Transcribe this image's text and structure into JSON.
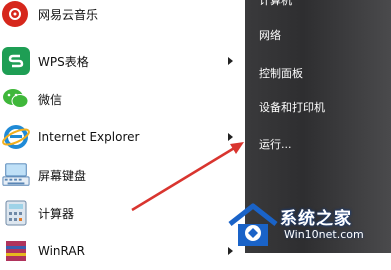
{
  "start_menu_left": {
    "items": [
      {
        "label": "网易云音乐",
        "icon": "netease-music-icon",
        "color": "#d6271c",
        "has_submenu": false
      },
      {
        "label": "WPS表格",
        "icon": "wps-spreadsheet-icon",
        "color": "#1e9e54",
        "has_submenu": true
      },
      {
        "label": "微信",
        "icon": "wechat-icon",
        "color": "#3fb73a",
        "has_submenu": false
      },
      {
        "label": "Internet Explorer",
        "icon": "internet-explorer-icon",
        "color": "#1f8ad6",
        "has_submenu": true
      },
      {
        "label": "屏幕键盘",
        "icon": "on-screen-keyboard-icon",
        "color": "#6aa0d8",
        "has_submenu": false
      },
      {
        "label": "计算器",
        "icon": "calculator-icon",
        "color": "#8fa7c2",
        "has_submenu": false
      },
      {
        "label": "WinRAR",
        "icon": "winrar-icon",
        "color": "#b0335c",
        "has_submenu": true
      }
    ]
  },
  "start_menu_right": {
    "items": [
      {
        "label": "计算机"
      },
      {
        "label": "网络"
      },
      {
        "label": "控制面板"
      },
      {
        "label": "设备和打印机"
      },
      {
        "label": "运行..."
      }
    ]
  },
  "watermark": {
    "title": "系统之家",
    "url": "Win10net.com"
  },
  "colors": {
    "arrow": "#d9352f",
    "right_panel": "#333335"
  }
}
